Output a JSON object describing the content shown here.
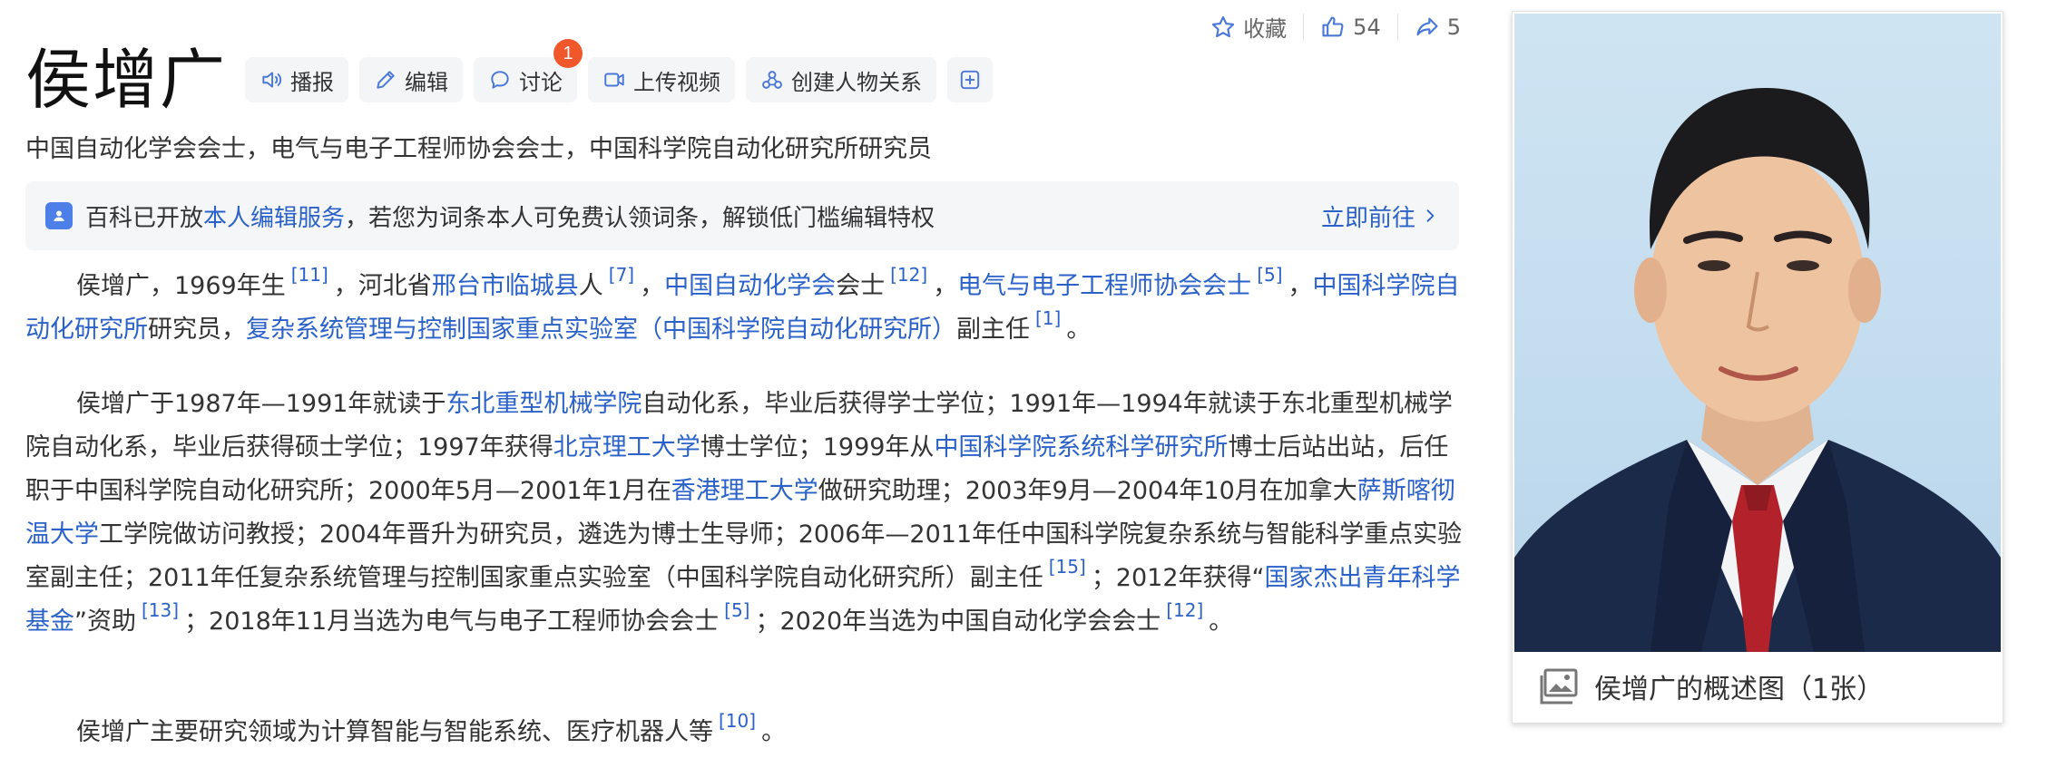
{
  "page": {
    "title": "侯增广",
    "subtitle": "中国自动化学会会士，电气与电子工程师协会会士，中国科学院自动化研究所研究员"
  },
  "top_actions": {
    "favorite_label": "收藏",
    "like_count": "54",
    "share_count": "5"
  },
  "toolbar": {
    "broadcast_label": "播报",
    "edit_label": "编辑",
    "discuss_label": "讨论",
    "discuss_badge": "1",
    "upload_video_label": "上传视频",
    "relation_label": "创建人物关系"
  },
  "notice": {
    "prefix": "百科已开放",
    "link": "本人编辑服务",
    "suffix": "，若您为词条本人可免费认领词条，解锁低门槛编辑特权",
    "goto": "立即前往"
  },
  "para1": {
    "t1": "侯增广，1969年生",
    "r1": "[11]",
    "t2": "，河北省",
    "l1": "邢台市临城县",
    "t3": "人",
    "r2": "[7]",
    "t4": "，",
    "l2": "中国自动化学会",
    "t5": "会士",
    "r3": "[12]",
    "t6": "，",
    "l3": "电气与电子工程师协会会士",
    "r4": "[5]",
    "t7": "，",
    "l4": "中国科学院自动化研究所",
    "t8": "研究员，",
    "l5": "复杂系统管理与控制国家重点实验室（中国科学院自动化研究所）",
    "t9": "副主任",
    "r5": "[1]",
    "t10": "。"
  },
  "para2": {
    "t1": "侯增广于1987年—1991年就读于",
    "l1": "东北重型机械学院",
    "t2": "自动化系，毕业后获得学士学位；1991年—1994年就读于东北重型机械学院自动化系，毕业后获得硕士学位；1997年获得",
    "l2": "北京理工大学",
    "t3": "博士学位；1999年从",
    "l3": "中国科学院系统科学研究所",
    "t4": "博士后站出站，后任职于中国科学院自动化研究所；2000年5月—2001年1月在",
    "l4": "香港理工大学",
    "t5": "做研究助理；2003年9月—2004年10月在加拿大",
    "l5": "萨斯喀彻温大学",
    "t6": "工学院做访问教授；2004年晋升为研究员，遴选为博士生导师；2006年—2011年任中国科学院复杂系统与智能科学重点实验室副主任；2011年任复杂系统管理与控制国家重点实验室（中国科学院自动化研究所）副主任",
    "r1": "[15]",
    "t7": "；2012年获得“",
    "l6": "国家杰出青年科学基金",
    "t8": "”资助",
    "r2": "[13]",
    "t9": "；2018年11月当选为电气与电子工程师协会会士",
    "r3": "[5]",
    "t10": "；2020年当选为中国自动化学会会士",
    "r4": "[12]",
    "t11": "。"
  },
  "para3": {
    "t1": "侯增广主要研究领域为计算智能与智能系统、医疗机器人等",
    "r1": "[10]",
    "t2": "。"
  },
  "photo_card": {
    "caption": "侯增广的概述图（1张）"
  },
  "colors": {
    "link": "#2a62c9",
    "badge": "#f0572a",
    "notice_bg": "#f5f6f8",
    "tool_bg": "#f4f5f7"
  },
  "icons": [
    "star-icon",
    "thumb-up-icon",
    "share-icon",
    "speaker-icon",
    "pencil-icon",
    "chat-bubble-icon",
    "video-icon",
    "relation-icon",
    "plus-box-icon",
    "user-badge-icon",
    "chevron-right-icon",
    "image-gallery-icon"
  ]
}
